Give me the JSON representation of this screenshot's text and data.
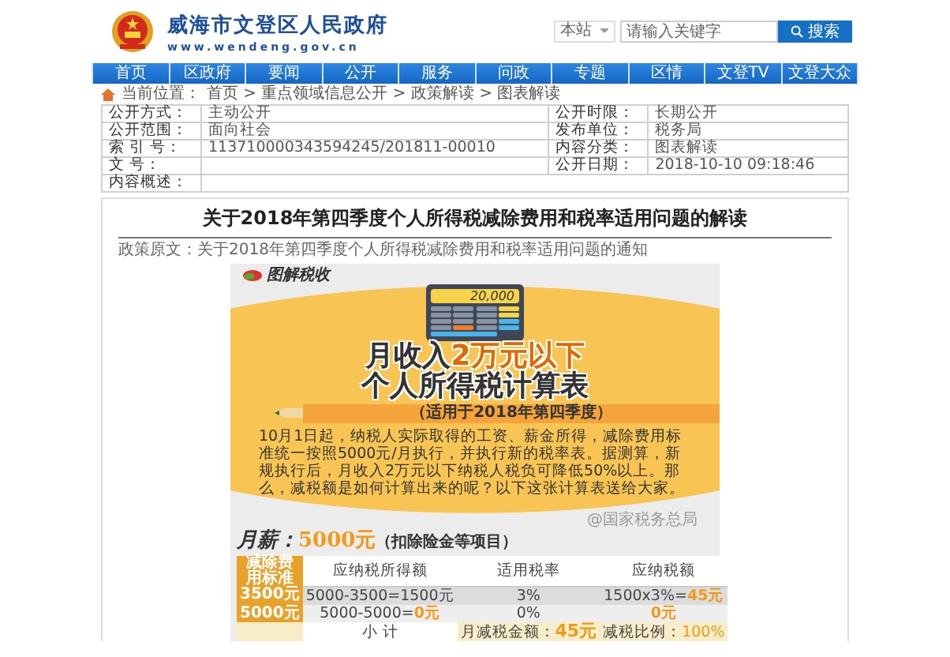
{
  "header": {
    "site_title": "威海市文登区人民政府",
    "site_url": "www.wendeng.gov.cn",
    "search": {
      "scope": "本站",
      "placeholder": "请输入关键字",
      "button": "搜索"
    }
  },
  "nav": [
    {
      "label": "首页"
    },
    {
      "label": "区政府"
    },
    {
      "label": "要闻"
    },
    {
      "label": "公开"
    },
    {
      "label": "服务"
    },
    {
      "label": "问政"
    },
    {
      "label": "专题"
    },
    {
      "label": "区情"
    },
    {
      "label": "文登TV"
    },
    {
      "label": "文登大众"
    }
  ],
  "breadcrumb": {
    "label": "当前位置：",
    "path": "首页 > 重点领域信息公开 > 政策解读 > 图表解读"
  },
  "info_table": [
    [
      {
        "label": "公开方式：",
        "value": "主动公开"
      },
      {
        "label": "公开时限：",
        "value": "长期公开"
      }
    ],
    [
      {
        "label": "公开范围：",
        "value": "面向社会"
      },
      {
        "label": "发布单位：",
        "value": "税务局"
      }
    ],
    [
      {
        "label": "索 引 号：",
        "value": "113710000343594245/201811-00010"
      },
      {
        "label": "内容分类：",
        "value": "图表解读"
      }
    ],
    [
      {
        "label": "文 号："
      },
      {
        "label": "公开日期：",
        "value": "2018-10-10 09:18:46"
      }
    ],
    [
      {
        "label": "内容概述："
      }
    ]
  ],
  "article": {
    "title": "关于2018年第四季度个人所得税减除费用和税率适用问题的解读",
    "source": "政策原文：关于2018年第四季度个人所得税减除费用和税率适用问题的通知",
    "infographic": {
      "brand": "图解税收",
      "calculator_display": "20,000",
      "title_lines": [
        [
          {
            "text": "月收入",
            "highlight": false
          },
          {
            "text": "2万元以下",
            "highlight": true
          }
        ],
        [
          {
            "text": "个人所得税计算表",
            "highlight": false
          }
        ]
      ],
      "subtitle": "（适用于2018年第四季度）",
      "paragraph": "10月1日起，纳税人实际取得的工资、薪金所得，减除费用标准统一按照5000元/月执行，并执行新的税率表。据测算，新规执行后，月收入2万元以下纳税人税负可降低50%以上。那么，减税额是如何计算出来的呢？以下这张计算表送给大家。",
      "credit": "@国家税务总局",
      "salary": {
        "label": "月薪：",
        "amount": "5000元",
        "note": "（扣除险金等项目）"
      },
      "table": {
        "columns": [
          "减除费用标准",
          "应纳税所得额",
          "适用税率",
          "应纳税额"
        ],
        "rows": [
          {
            "standard": "3500元",
            "taxable": [
              {
                "text": "5000-3500=1500元",
                "highlight": false
              }
            ],
            "rate": "3%",
            "tax": [
              {
                "text": "1500x3%=",
                "highlight": false
              },
              {
                "text": "45元",
                "highlight": true
              }
            ]
          },
          {
            "standard": "5000元",
            "taxable": [
              {
                "text": "5000-5000=",
                "highlight": false
              },
              {
                "text": "0元",
                "highlight": true
              }
            ],
            "rate": "0%",
            "tax": [
              {
                "text": "0元",
                "highlight": true
              }
            ]
          }
        ],
        "subtotal": {
          "label": "小 计",
          "saving_label": "月减税金额：",
          "saving": "45元",
          "ratio_label": "减税比例：",
          "ratio": "100%"
        }
      }
    }
  }
}
